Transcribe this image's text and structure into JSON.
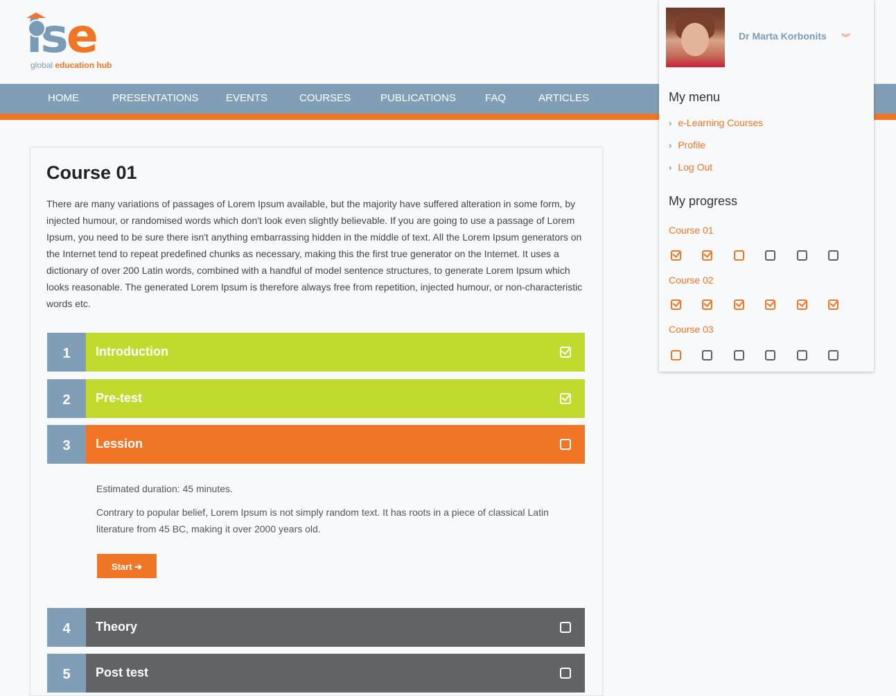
{
  "brand": {
    "logo_text_i": "i",
    "logo_text_s": "s",
    "logo_text_e": "e",
    "tagline_part1": "global",
    "tagline_part2": "education hub",
    "colors": {
      "primary": "#809fb6",
      "accent": "#f07524",
      "done": "#c2d92d",
      "locked": "#626366"
    }
  },
  "nav": {
    "items": [
      "HOME",
      "PRESENTATIONS",
      "EVENTS",
      "COURSES",
      "PUBLICATIONS",
      "FAQ",
      "ARTICLES"
    ]
  },
  "course": {
    "title": "Course 01",
    "description": "There are many variations of passages of Lorem Ipsum available, but the majority have suffered alteration in some form, by injected humour, or randomised words which don't look even slightly believable. If you are going to use a passage of Lorem Ipsum, you need to be sure there isn't anything embarrassing hidden in the middle of text. All the Lorem Ipsum generators on the Internet tend to repeat predefined chunks as necessary, making this the first true generator on the Internet. It uses a dictionary of over 200 Latin words, combined with a handful of model sentence structures, to generate Lorem Ipsum which looks reasonable. The generated Lorem Ipsum is therefore always free from repetition, injected humour, or non-characteristic words etc.",
    "steps": [
      {
        "num": "1",
        "label": "Introduction",
        "status": "done"
      },
      {
        "num": "2",
        "label": "Pre-test",
        "status": "done"
      },
      {
        "num": "3",
        "label": "Lession",
        "status": "current"
      },
      {
        "num": "4",
        "label": "Theory",
        "status": "locked"
      },
      {
        "num": "5",
        "label": "Post test",
        "status": "locked"
      }
    ],
    "lesson": {
      "duration": "Estimated duration: 45 minutes.",
      "text": "Contrary to popular belief, Lorem Ipsum is not simply random text. It has roots in a piece of classical Latin literature from 45 BC, making it over 2000 years old.",
      "start_label": "Start",
      "start_icon": "arrow-right-icon"
    }
  },
  "user": {
    "name": "Dr Marta Korbonits",
    "chevron_icon": "double-chevron-down-icon"
  },
  "my_menu": {
    "title": "My menu",
    "items": [
      "e-Learning Courses",
      "Profile",
      "Log Out"
    ]
  },
  "my_progress": {
    "title": "My progress",
    "courses": [
      {
        "name": "Course 01",
        "states": [
          "done",
          "done",
          "current",
          "todo",
          "todo",
          "todo"
        ]
      },
      {
        "name": "Course 02",
        "states": [
          "done",
          "done",
          "done",
          "done",
          "done",
          "done"
        ]
      },
      {
        "name": "Course 03",
        "states": [
          "current",
          "todo",
          "todo",
          "todo",
          "todo",
          "todo"
        ]
      }
    ]
  }
}
